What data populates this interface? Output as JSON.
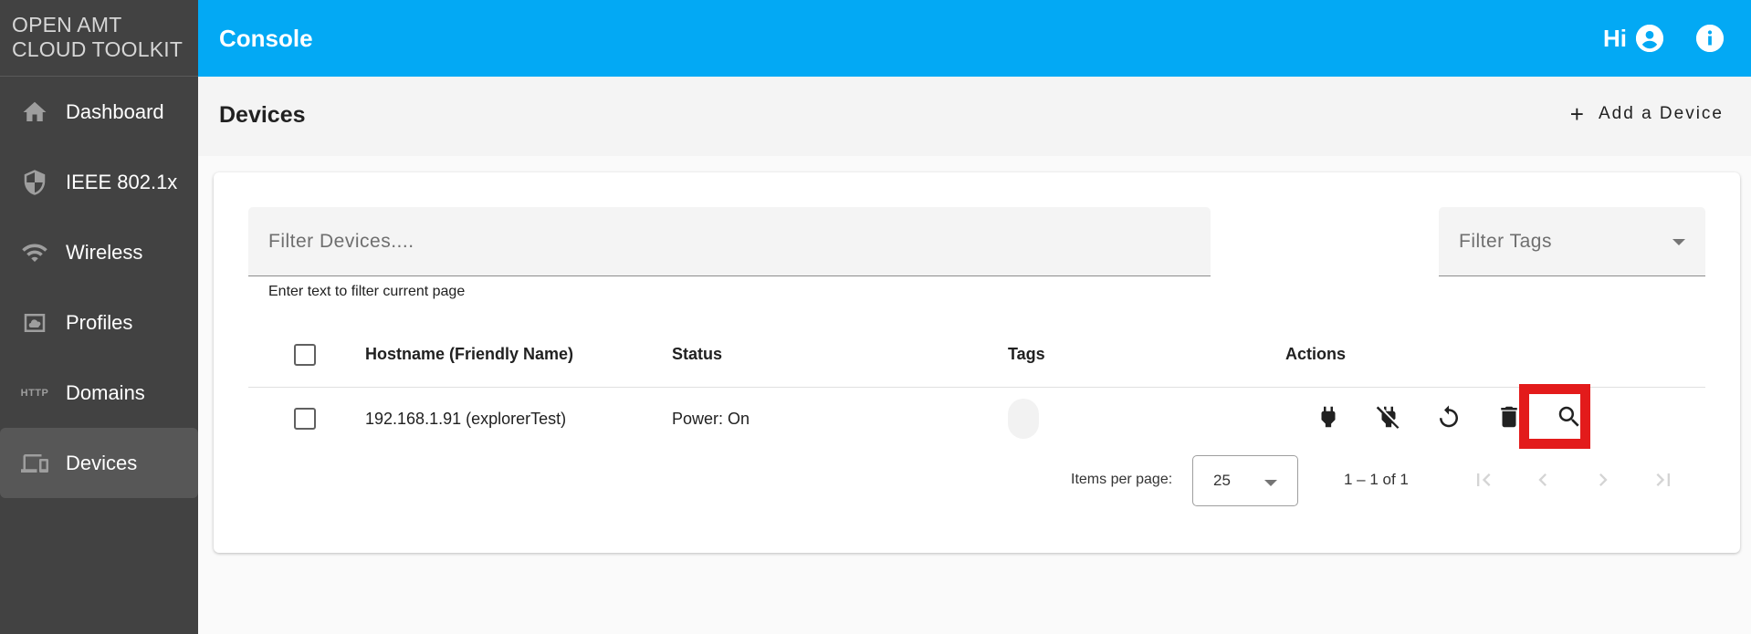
{
  "sidebar": {
    "brand_line1": "OPEN AMT",
    "brand_line2": "CLOUD TOOLKIT",
    "items": [
      {
        "label": "Dashboard",
        "icon": "home-icon",
        "active": false
      },
      {
        "label": "IEEE 802.1x",
        "icon": "shield-icon",
        "active": false
      },
      {
        "label": "Wireless",
        "icon": "wifi-icon",
        "active": false
      },
      {
        "label": "Profiles",
        "icon": "profile-cloud-icon",
        "active": false
      },
      {
        "label": "Domains",
        "icon": "http-icon",
        "icon_text": "HTTP",
        "active": false
      },
      {
        "label": "Devices",
        "icon": "devices-icon",
        "active": true
      }
    ]
  },
  "header": {
    "title": "Console",
    "greeting": "Hi",
    "brand_color": "#03a9f4"
  },
  "page": {
    "title": "Devices",
    "add_button_icon": "+",
    "add_button_label": "Add a Device"
  },
  "filters": {
    "devices_placeholder": "Filter Devices....",
    "devices_value": "",
    "devices_hint": "Enter text to filter current page",
    "tags_placeholder": "Filter Tags"
  },
  "table": {
    "columns": [
      "Hostname (Friendly Name)",
      "Status",
      "Tags",
      "Actions"
    ],
    "rows": [
      {
        "hostname": "192.168.1.91 (explorerTest)",
        "status": "Power: On",
        "tags": [],
        "actions": [
          "power-on-icon",
          "power-off-icon",
          "reset-icon",
          "delete-icon",
          "details-search-icon"
        ]
      }
    ]
  },
  "paginator": {
    "items_per_page_label": "Items per page:",
    "items_per_page": "25",
    "range_label": "1 – 1 of 1"
  },
  "highlight": {
    "target": "details-search-icon",
    "color": "#e31b1b"
  }
}
